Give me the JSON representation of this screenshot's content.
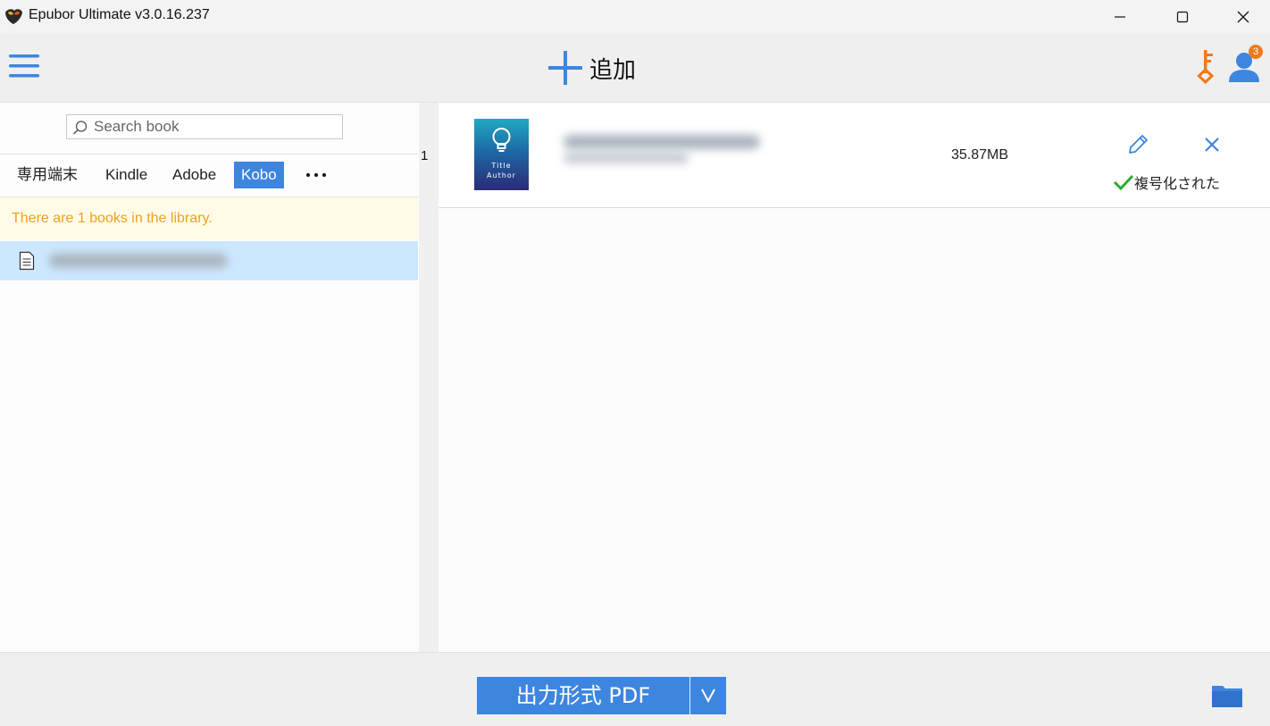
{
  "window": {
    "title": "Epubor Ultimate v3.0.16.237"
  },
  "toolbar": {
    "add_label": "追加",
    "notification_count": "3"
  },
  "search": {
    "placeholder": "Search book",
    "value": ""
  },
  "tabs": [
    {
      "label": "専用端末",
      "active": false
    },
    {
      "label": "Kindle",
      "active": false
    },
    {
      "label": "Adobe",
      "active": false
    },
    {
      "label": "Kobo",
      "active": true
    }
  ],
  "library": {
    "notice": "There are 1 books in the library."
  },
  "books": [
    {
      "index": "1",
      "cover_title": "Title",
      "cover_author": "Author",
      "size": "35.87MB",
      "status": "複号化された"
    }
  ],
  "footer": {
    "output_label": "出力形式 PDF"
  },
  "colors": {
    "accent": "#3e85e0",
    "key_orange": "#f07a1a",
    "notice_text": "#f0a020",
    "success_green": "#2eaa2e",
    "selected_row": "#cce8ff"
  },
  "icons": {
    "menu": "hamburger-icon",
    "add": "plus-icon",
    "key": "key-icon",
    "user": "user-icon",
    "search": "search-icon",
    "more": "ellipsis-icon",
    "document": "document-icon",
    "edit": "pencil-icon",
    "remove": "close-icon",
    "status": "check-icon",
    "folder": "folder-icon"
  }
}
